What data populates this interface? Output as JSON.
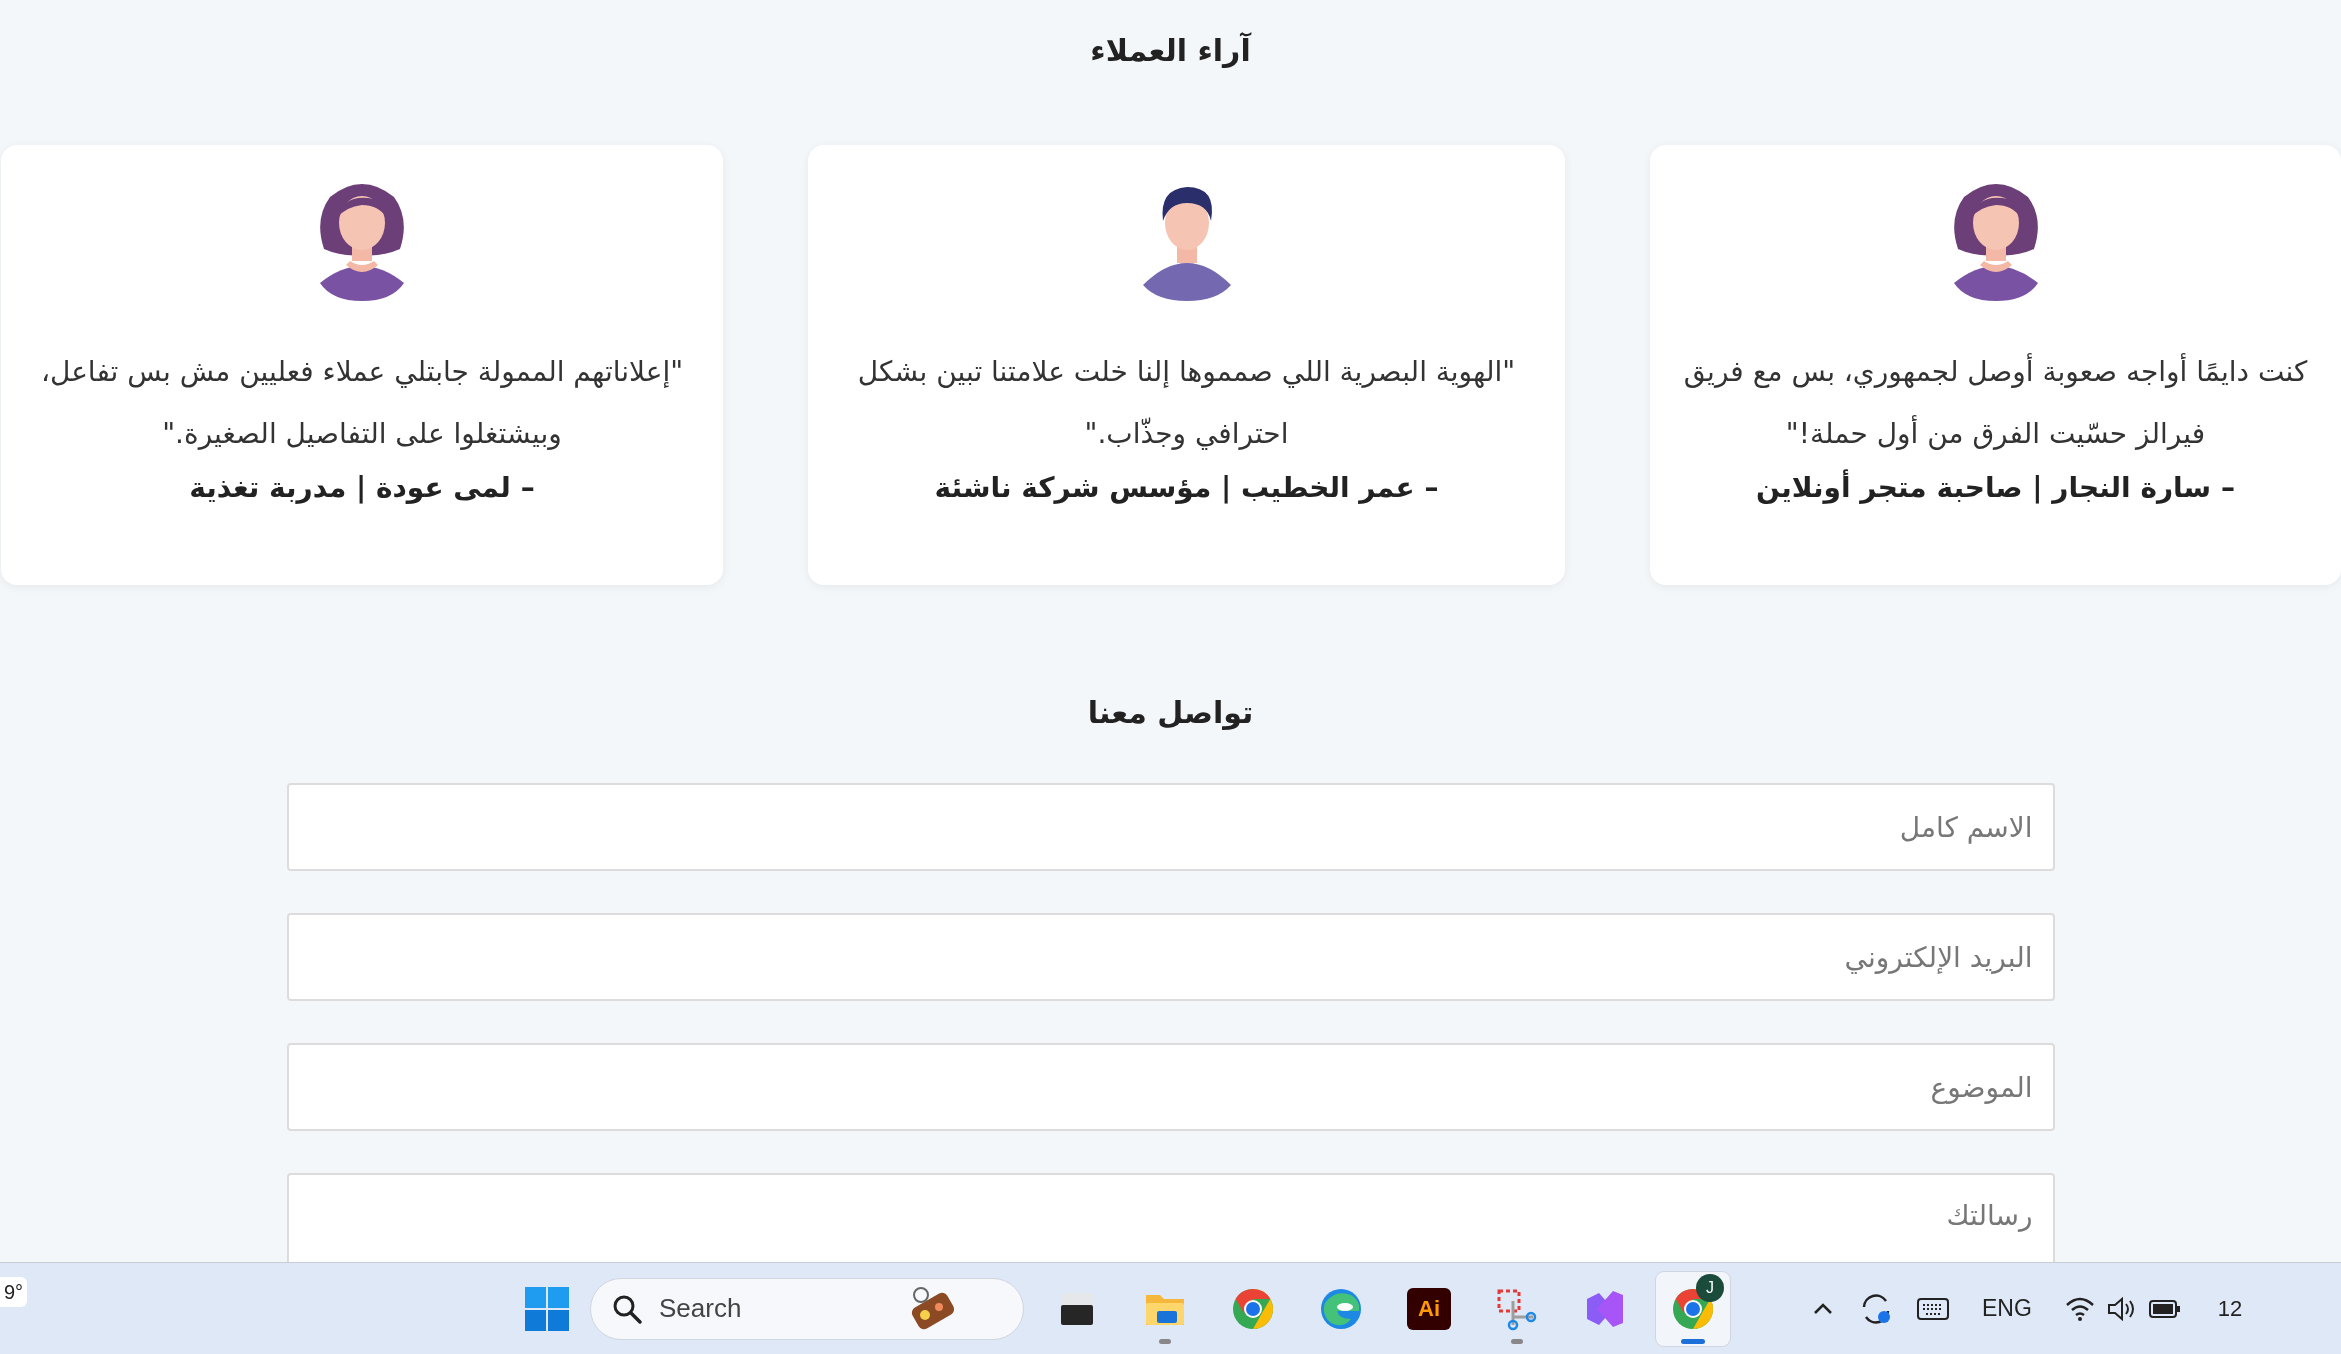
{
  "testimonials": {
    "title": "آراء العملاء",
    "cards": [
      {
        "avatar": {
          "kind": "woman"
        },
        "quote": "كنت دايمًا أواجه صعوبة أوصل لجمهوري، بس مع فريق فيرالز حسّيت الفرق من أول حملة!\"",
        "author": "– سارة النجار | صاحبة متجر أونلاين"
      },
      {
        "avatar": {
          "kind": "man"
        },
        "quote": "\"الهوية البصرية اللي صمموها إلنا خلت علامتنا تبين بشكل احترافي وجذّاب.\"",
        "author": "– عمر الخطيب | مؤسس شركة ناشئة"
      },
      {
        "avatar": {
          "kind": "woman"
        },
        "quote": "\"إعلاناتهم الممولة جابتلي عملاء فعليين مش بس تفاعل، وبيشتغلوا على التفاصيل الصغيرة.\"",
        "author": "– لمى عودة | مدربة تغذية"
      }
    ]
  },
  "contact": {
    "title": "تواصل معنا",
    "fields": [
      {
        "kind": "input",
        "placeholder": "الاسم كامل"
      },
      {
        "kind": "input",
        "placeholder": "البريد الإلكتروني"
      },
      {
        "kind": "input",
        "placeholder": "الموضوع"
      },
      {
        "kind": "textarea",
        "placeholder": "رسالتك"
      }
    ]
  },
  "taskbar": {
    "weather": "9°",
    "search_placeholder": "Search",
    "apps": [
      {
        "kind": "terminal",
        "running": false,
        "selected": false
      },
      {
        "kind": "folder",
        "running": true,
        "selected": false
      },
      {
        "kind": "chrome",
        "running": false,
        "selected": false
      },
      {
        "kind": "edge",
        "running": false,
        "selected": false
      },
      {
        "kind": "illustrator",
        "label": "Ai",
        "running": false,
        "selected": false
      },
      {
        "kind": "snipping",
        "running": true,
        "selected": false
      },
      {
        "kind": "studio",
        "running": false,
        "selected": false
      },
      {
        "kind": "chrome",
        "badge": "J",
        "running": true,
        "selected": true
      }
    ],
    "language": "ENG",
    "clock": "12"
  }
}
